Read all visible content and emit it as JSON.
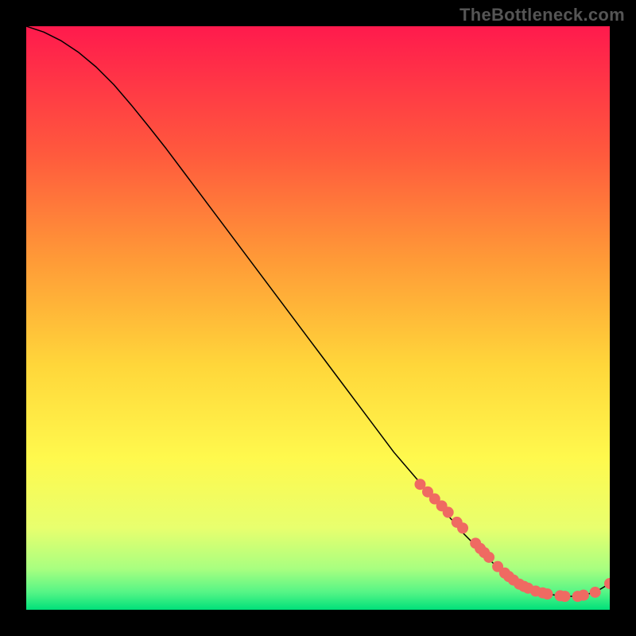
{
  "watermark": "TheBottleneck.com",
  "chart_data": {
    "type": "line",
    "title": "",
    "xlabel": "",
    "ylabel": "",
    "xlim": [
      0,
      100
    ],
    "ylim": [
      0,
      100
    ],
    "grid": false,
    "legend": false,
    "background_gradient": {
      "top": "#ff1a4d",
      "mid_upper": "#ff7e3d",
      "middle": "#ffd63a",
      "mid_lower": "#f9ff6a",
      "near_bottom": "#7fff7f",
      "bottom": "#00e07a"
    },
    "series": [
      {
        "name": "curve",
        "type": "line",
        "color": "#000000",
        "stroke_width": 1.5,
        "x": [
          0,
          3,
          6,
          9,
          12,
          15,
          18,
          21,
          24,
          27,
          30,
          33,
          36,
          39,
          42,
          45,
          48,
          51,
          54,
          57,
          60,
          63,
          66,
          69,
          72,
          75,
          78,
          80,
          82,
          84,
          86,
          88,
          90,
          92,
          94,
          96,
          98,
          100
        ],
        "y": [
          100,
          99,
          97.5,
          95.5,
          93,
          90,
          86.5,
          82.8,
          79,
          75,
          71,
          67,
          63,
          59,
          55,
          51,
          47,
          43,
          39,
          35,
          31,
          27,
          23.5,
          20,
          16.5,
          13,
          10,
          8,
          6.3,
          5,
          3.9,
          3.1,
          2.6,
          2.3,
          2.3,
          2.6,
          3.3,
          4.5
        ]
      },
      {
        "name": "markers",
        "type": "scatter",
        "color": "#ef6a62",
        "radius": 7,
        "x": [
          67.5,
          68.8,
          70.0,
          71.2,
          72.3,
          73.8,
          74.8,
          77.0,
          77.8,
          78.5,
          79.3,
          80.8,
          82.0,
          82.7,
          83.5,
          84.5,
          85.3,
          86.0,
          87.3,
          88.5,
          89.3,
          91.5,
          92.3,
          94.5,
          95.5,
          97.5,
          100.0
        ],
        "y": [
          21.5,
          20.2,
          19.0,
          17.8,
          16.7,
          15.0,
          14.0,
          11.4,
          10.5,
          9.8,
          9.0,
          7.4,
          6.3,
          5.7,
          5.1,
          4.4,
          4.0,
          3.7,
          3.2,
          2.9,
          2.7,
          2.4,
          2.3,
          2.3,
          2.5,
          3.0,
          4.5
        ]
      }
    ]
  }
}
